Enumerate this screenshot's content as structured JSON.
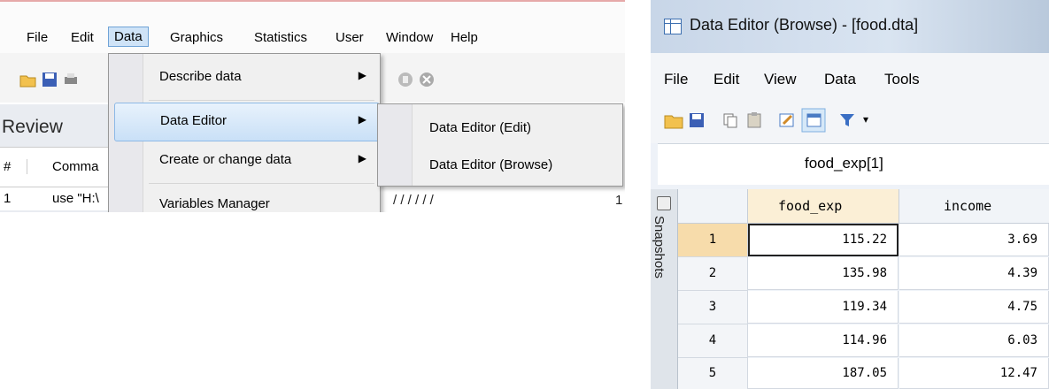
{
  "main_window": {
    "menubar": [
      "File",
      "Edit",
      "Data",
      "Graphics",
      "Statistics",
      "User",
      "Window",
      "Help"
    ],
    "active_menu": "Data",
    "review": {
      "title": "Review",
      "col_number": "#",
      "col_command": "Comma",
      "row_number": "1",
      "row_command": "use \"H:\\"
    },
    "data_menu": {
      "items": [
        {
          "label": "Describe data",
          "submenu": true
        },
        {
          "label": "Data Editor",
          "submenu": true
        },
        {
          "label": "Create or change data",
          "submenu": true
        },
        {
          "label": "Variables Manager",
          "submenu": false
        }
      ],
      "highlighted": "Data Editor"
    },
    "submenu": {
      "items": [
        "Data Editor (Edit)",
        "Data Editor (Browse)"
      ]
    },
    "background_text": "/   /   /   /   /   /",
    "background_end": "1"
  },
  "data_editor": {
    "title": "Data Editor (Browse) - [food.dta]",
    "menubar": [
      "File",
      "Edit",
      "View",
      "Data",
      "Tools"
    ],
    "cell_indicator": "food_exp[1]",
    "snapshots_label": "Snapshots",
    "columns": [
      "food_exp",
      "income"
    ],
    "rows": [
      {
        "n": "1",
        "food_exp": "115.22",
        "income": "3.69"
      },
      {
        "n": "2",
        "food_exp": "135.98",
        "income": "4.39"
      },
      {
        "n": "3",
        "food_exp": "119.34",
        "income": "4.75"
      },
      {
        "n": "4",
        "food_exp": "114.96",
        "income": "6.03"
      },
      {
        "n": "5",
        "food_exp": "187.05",
        "income": "12.47"
      }
    ],
    "selected_row": "1",
    "selected_column": "food_exp"
  },
  "colors": {
    "menu_highlight": "#c9e0f7",
    "selected_row": "#f7dcab",
    "filter_icon": "#3a6fc4"
  }
}
